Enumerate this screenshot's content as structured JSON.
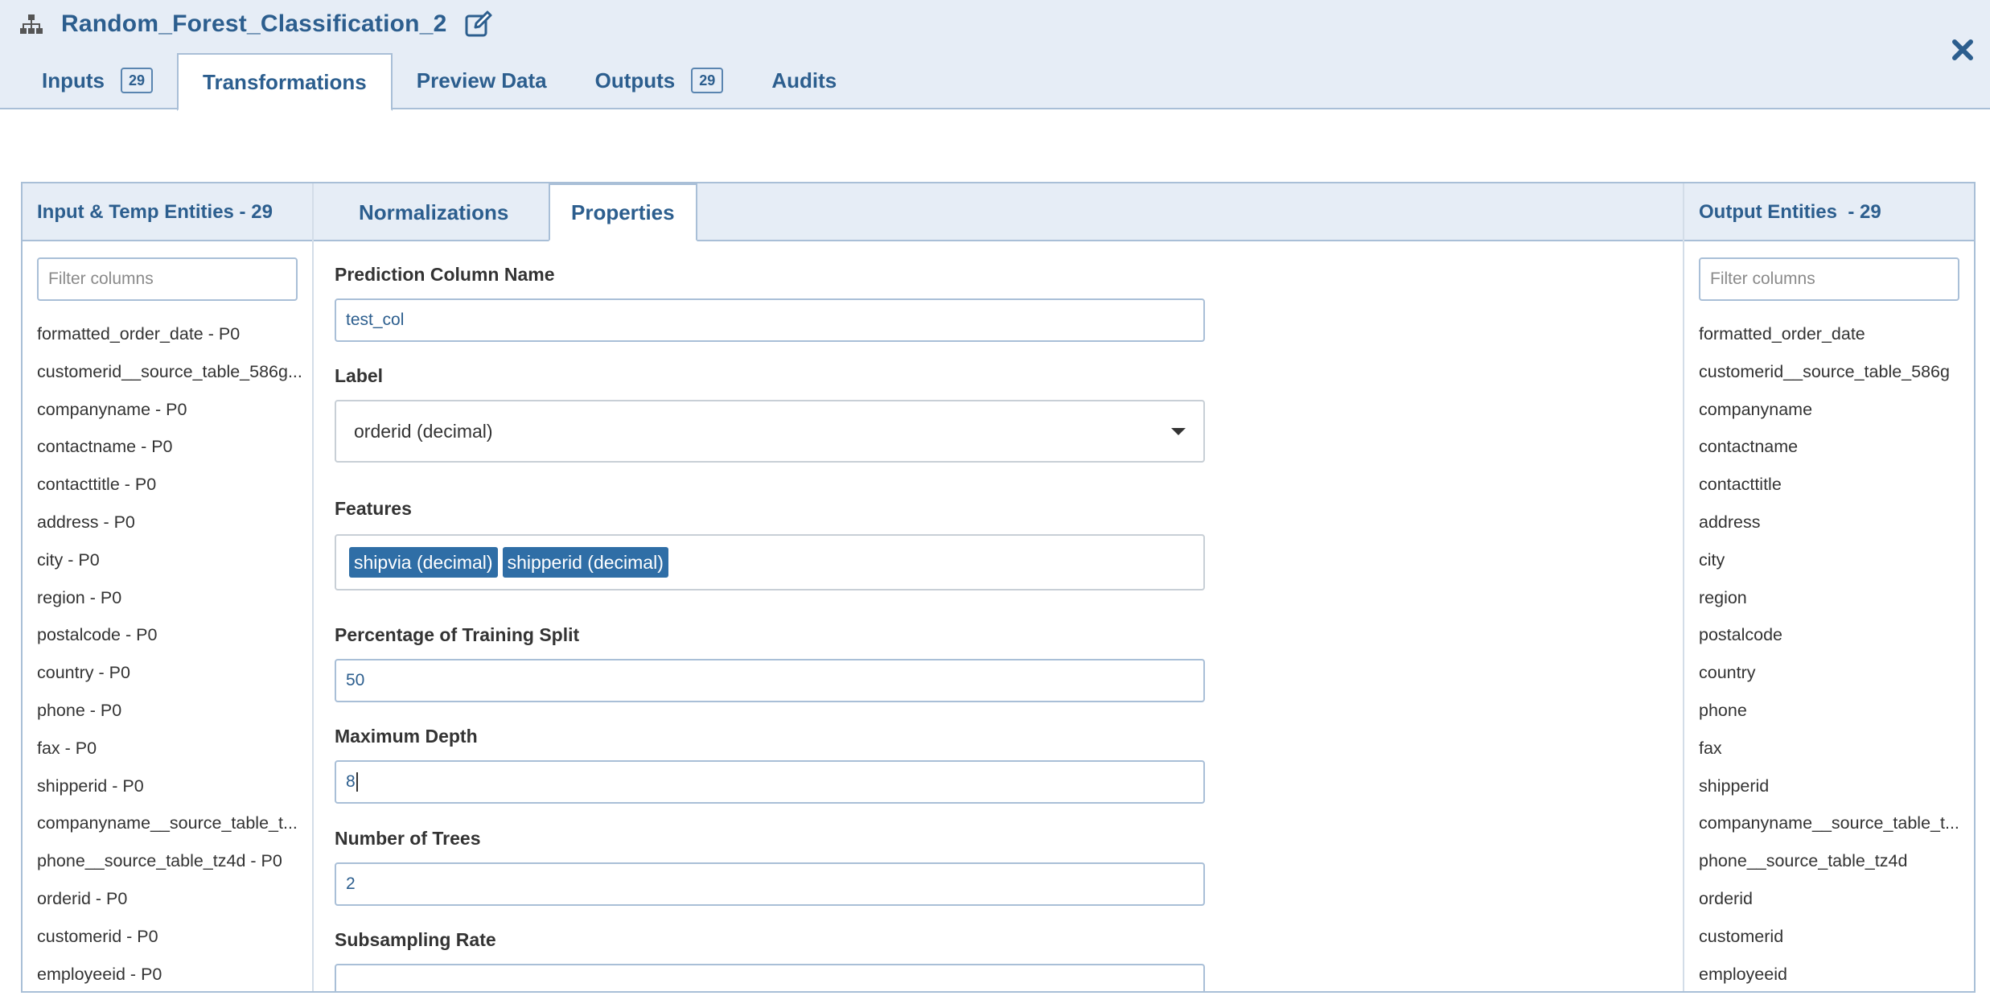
{
  "header": {
    "title": "Random_Forest_Classification_2",
    "tabs": [
      {
        "label": "Inputs",
        "badge": "29"
      },
      {
        "label": "Transformations"
      },
      {
        "label": "Preview Data"
      },
      {
        "label": "Outputs",
        "badge": "29"
      },
      {
        "label": "Audits"
      }
    ],
    "active_tab": "Transformations",
    "icons": {
      "title": "hierarchy-icon",
      "edit": "edit-icon",
      "close": "close-icon"
    }
  },
  "left_panel": {
    "title": "Input & Temp Entities - 29",
    "filter_placeholder": "Filter columns",
    "items": [
      "formatted_order_date - P0",
      "customerid__source_table_586g...",
      "companyname - P0",
      "contactname - P0",
      "contacttitle - P0",
      "address - P0",
      "city - P0",
      "region - P0",
      "postalcode - P0",
      "country - P0",
      "phone - P0",
      "fax - P0",
      "shipperid - P0",
      "companyname__source_table_t...",
      "phone__source_table_tz4d - P0",
      "orderid - P0",
      "customerid - P0",
      "employeeid - P0"
    ]
  },
  "middle_panel": {
    "tabs": [
      "Normalizations",
      "Properties"
    ],
    "active_tab": "Properties",
    "fields": {
      "prediction_column_label": "Prediction Column Name",
      "prediction_column_value": "test_col",
      "label_label": "Label",
      "label_value": "orderid (decimal)",
      "features_label": "Features",
      "features": [
        "shipvia (decimal)",
        "shipperid (decimal)"
      ],
      "training_split_label": "Percentage of Training Split",
      "training_split_value": "50",
      "max_depth_label": "Maximum Depth",
      "max_depth_value": "8",
      "num_trees_label": "Number of Trees",
      "num_trees_value": "2",
      "subsampling_label": "Subsampling Rate"
    }
  },
  "right_panel": {
    "title": "Output Entities  - 29",
    "filter_placeholder": "Filter columns",
    "items": [
      "formatted_order_date",
      "customerid__source_table_586g",
      "companyname",
      "contactname",
      "contacttitle",
      "address",
      "city",
      "region",
      "postalcode",
      "country",
      "phone",
      "fax",
      "shipperid",
      "companyname__source_table_t...",
      "phone__source_table_tz4d",
      "orderid",
      "customerid",
      "employeeid"
    ]
  },
  "colors": {
    "accent": "#2c5e8e",
    "header_bg": "#e6edf6",
    "border": "#a9bfd7",
    "tag_bg": "#2f6ea6"
  }
}
